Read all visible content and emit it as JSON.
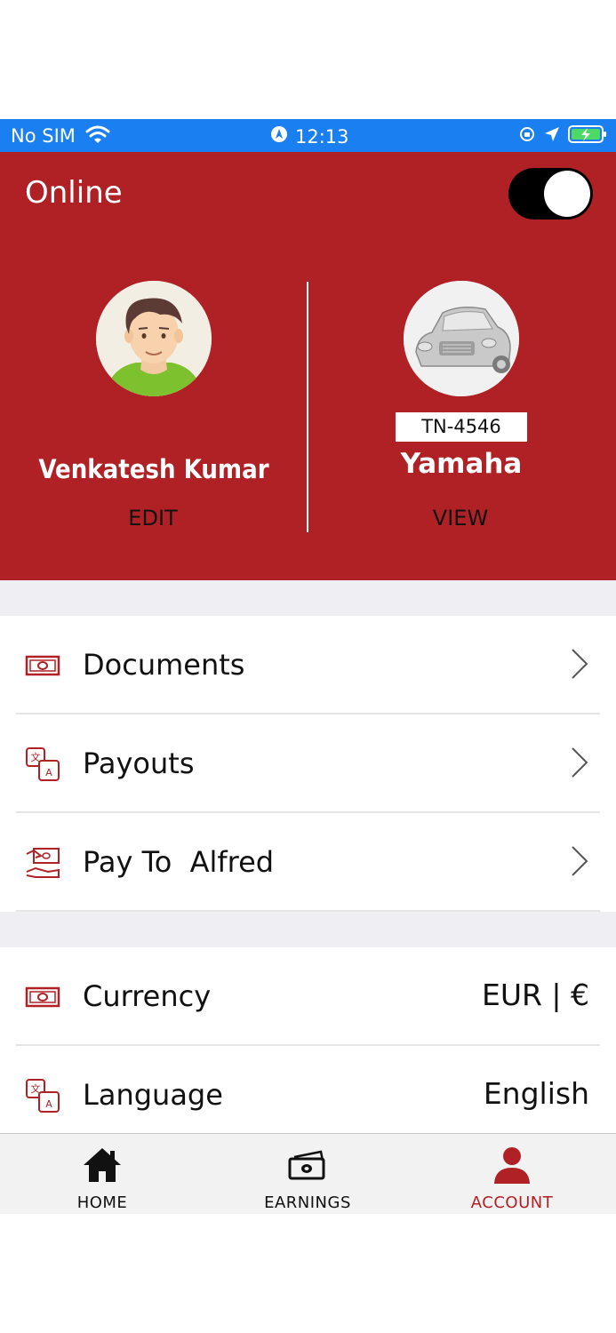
{
  "status_bar": {
    "carrier": "No SIM",
    "time": "12:13"
  },
  "header": {
    "online_label": "Online",
    "online_toggle": true,
    "driver_name": "Venkatesh Kumar",
    "edit_label": "EDIT",
    "plate_number": "TN-4546",
    "vehicle_name": "Yamaha",
    "view_label": "VIEW"
  },
  "menu": {
    "section1": [
      {
        "label": "Documents",
        "icon": "cash-icon"
      },
      {
        "label": "Payouts",
        "icon": "translate-icon"
      },
      {
        "label": "Pay To  Alfred",
        "icon": "pay-hand-icon"
      }
    ],
    "section2": [
      {
        "label": "Currency",
        "value": "EUR | €",
        "icon": "cash-icon"
      },
      {
        "label": "Language",
        "value": "English",
        "icon": "translate-icon"
      }
    ]
  },
  "tabs": [
    {
      "label": "HOME",
      "icon": "home-icon"
    },
    {
      "label": "EARNINGS",
      "icon": "money-icon"
    },
    {
      "label": "ACCOUNT",
      "icon": "person-icon",
      "active": true
    }
  ],
  "colors": {
    "brand_red": "#b02126",
    "status_blue": "#1a7ff0",
    "gap_gray": "#efeff3"
  }
}
